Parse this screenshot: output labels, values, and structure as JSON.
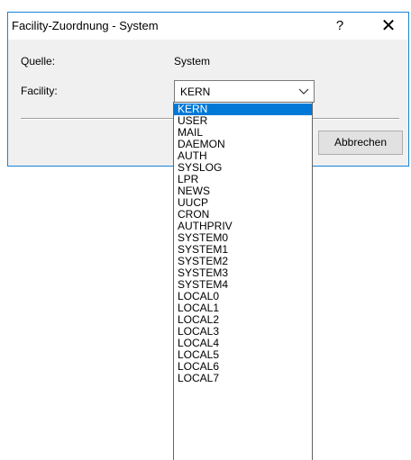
{
  "dialog": {
    "title": "Facility-Zuordnung - System",
    "help_label": "?",
    "close_label": "✕",
    "quelle_label": "Quelle:",
    "quelle_value": "System",
    "facility_label": "Facility:",
    "facility_selected": "KERN",
    "ok_label": "",
    "cancel_label": "Abbrechen"
  },
  "dropdown": {
    "options": [
      "KERN",
      "USER",
      "MAIL",
      "DAEMON",
      "AUTH",
      "SYSLOG",
      "LPR",
      "NEWS",
      "UUCP",
      "CRON",
      "AUTHPRIV",
      "SYSTEM0",
      "SYSTEM1",
      "SYSTEM2",
      "SYSTEM3",
      "SYSTEM4",
      "LOCAL0",
      "LOCAL1",
      "LOCAL2",
      "LOCAL3",
      "LOCAL4",
      "LOCAL5",
      "LOCAL6",
      "LOCAL7"
    ],
    "highlighted": "KERN"
  },
  "colors": {
    "accent": "#0078d7",
    "window_border": "#1883d7",
    "dialog_bg": "#f0f0f0"
  },
  "icons": {
    "help": "question-mark",
    "close": "close-x",
    "combo": "chevron-down"
  }
}
